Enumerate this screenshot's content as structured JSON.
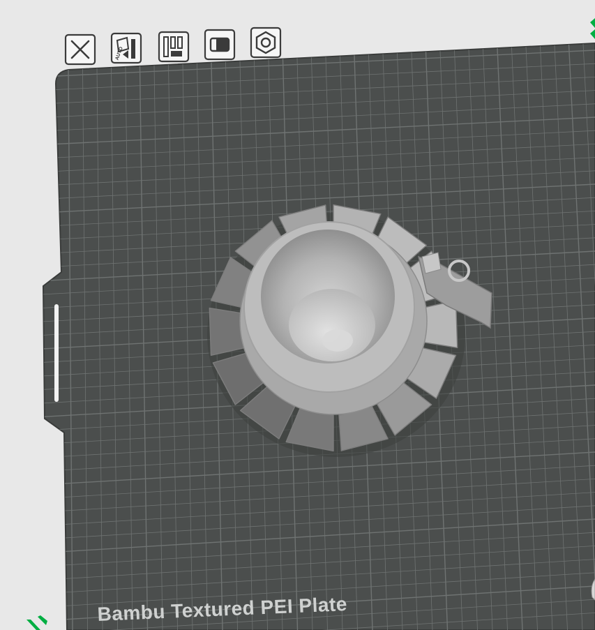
{
  "plate": {
    "label": "Bambu Textured PEI Plate"
  },
  "toolbar": {
    "buttons": [
      {
        "name": "close-plate-button",
        "icon": "close-icon"
      },
      {
        "name": "auto-orient-button",
        "icon": "auto-orient-icon",
        "badge": "AUTO"
      },
      {
        "name": "arrange-button",
        "icon": "arrange-icon"
      },
      {
        "name": "lock-plate-button",
        "icon": "lock-icon"
      },
      {
        "name": "plate-settings-button",
        "icon": "nut-settings-icon"
      }
    ]
  },
  "colors": {
    "background": "#e8e8e8",
    "plate": "#4b4e4d",
    "grid_line": "#6f7372",
    "plate_label": "#cfd1d0",
    "model": "#b9b9b9",
    "accent": "#00ae42"
  }
}
